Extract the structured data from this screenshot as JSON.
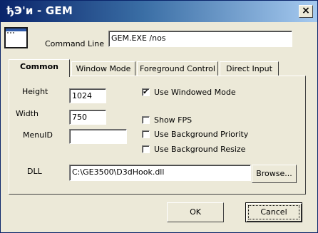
{
  "window": {
    "title": "ђЭ'и - GEM",
    "close_glyph": "×"
  },
  "command_line": {
    "label": "Command Line",
    "value": "GEM.EXE /nos"
  },
  "tabs": [
    {
      "label": "Common",
      "active": true
    },
    {
      "label": "Window Mode",
      "active": false
    },
    {
      "label": "Foreground Control",
      "active": false
    },
    {
      "label": "Direct Input",
      "active": false
    }
  ],
  "common": {
    "height_label": "Height",
    "height_value": "1024",
    "width_label": "Width",
    "width_value": "750",
    "menuid_label": "MenuID",
    "menuid_value": "",
    "dll_label": "DLL",
    "dll_value": "C:\\GE3500\\D3dHook.dll",
    "browse_label": "Browse...",
    "options": [
      {
        "label": "Use Windowed Mode",
        "checked": true
      },
      {
        "label": "Show FPS",
        "checked": false
      },
      {
        "label": "Use Background Priority",
        "checked": false
      },
      {
        "label": "Use Background Resize",
        "checked": false
      }
    ]
  },
  "buttons": {
    "ok": "OK",
    "cancel": "Cancel"
  },
  "colors": {
    "title_start": "#0a246a",
    "title_end": "#a6caf0",
    "face": "#ece9d8"
  },
  "icons": {
    "app": "window-app-icon",
    "close": "close-icon",
    "check": "checkmark-icon"
  }
}
